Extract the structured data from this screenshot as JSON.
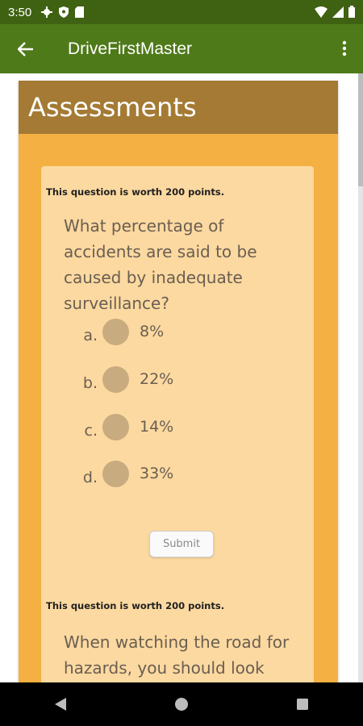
{
  "status_bar": {
    "time": "3:50"
  },
  "app_bar": {
    "title": "DriveFirstMaster"
  },
  "panel": {
    "title": "Assessments"
  },
  "questions": [
    {
      "worth": "This question is worth 200 points.",
      "text": "What percentage of accidents are said to be caused by inadequate surveillance?",
      "options": [
        {
          "letter": "a.",
          "label": "8%"
        },
        {
          "letter": "b.",
          "label": "22%"
        },
        {
          "letter": "c.",
          "label": "14%"
        },
        {
          "letter": "d.",
          "label": "33%"
        }
      ],
      "submit_label": "Submit"
    },
    {
      "worth": "This question is worth 200 points.",
      "text": "When watching the road for hazards, you should look"
    }
  ],
  "colors": {
    "status_bar": "#3f6212",
    "app_bar": "#4f7a1a",
    "panel": "#f4b042",
    "panel_header": "#a47a34",
    "card": "#fcd9a0",
    "radio": "#c8ab7f"
  }
}
